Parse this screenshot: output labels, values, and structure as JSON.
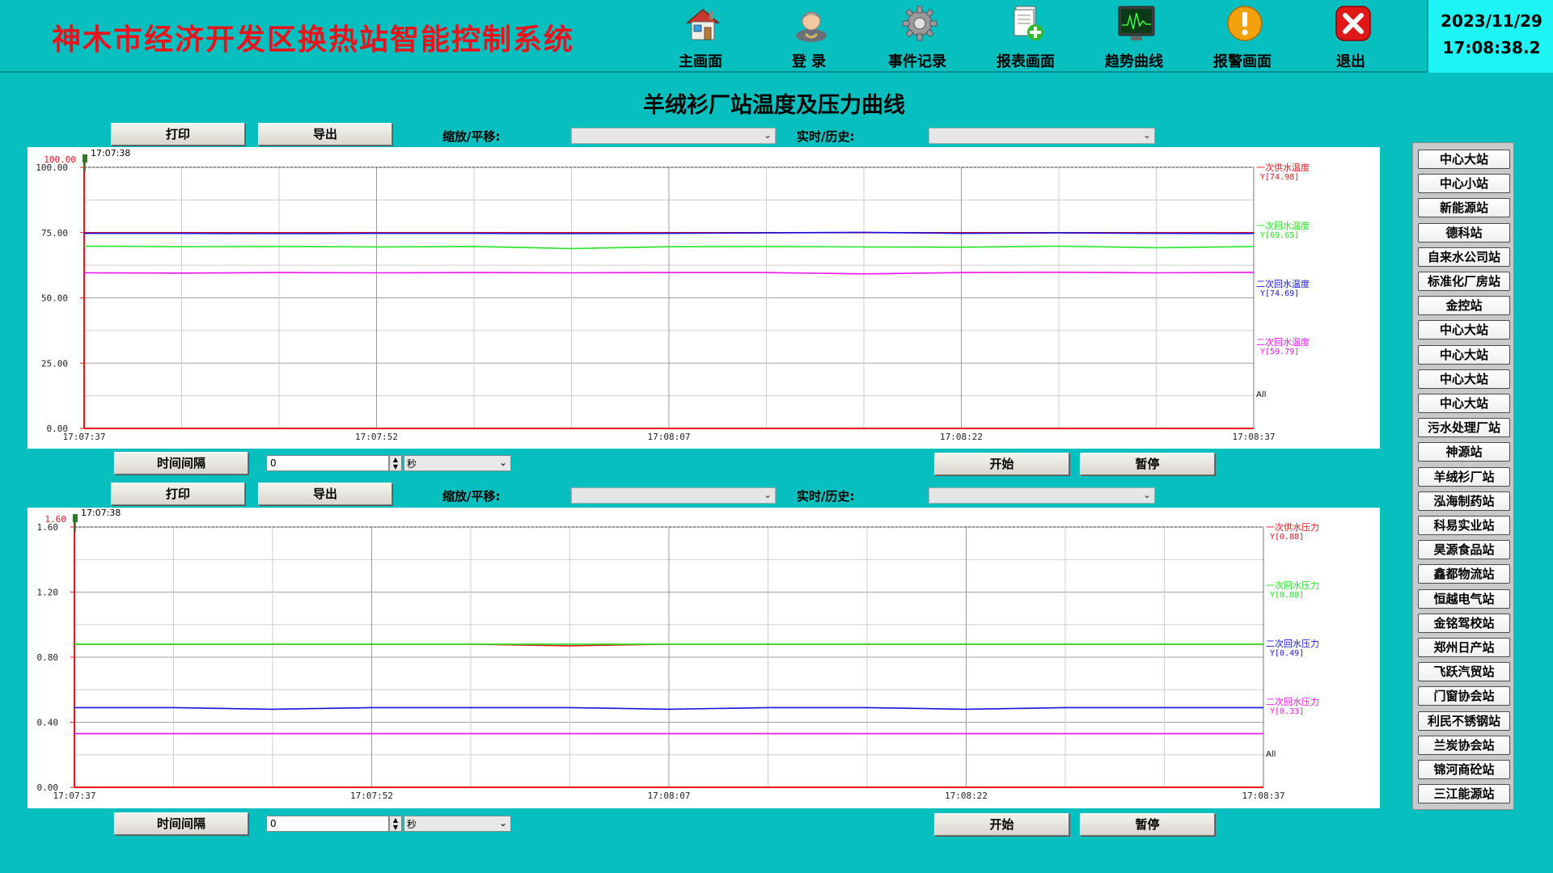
{
  "header": {
    "app_title": "神木市经济开发区换热站智能控制系统",
    "nav": [
      {
        "label": "主画面",
        "icon": "home-icon"
      },
      {
        "label": "登  录",
        "icon": "user-icon"
      },
      {
        "label": "事件记录",
        "icon": "gear-icon"
      },
      {
        "label": "报表画面",
        "icon": "report-add-icon"
      },
      {
        "label": "趋势曲线",
        "icon": "trend-monitor-icon"
      },
      {
        "label": "报警画面",
        "icon": "warning-icon"
      },
      {
        "label": "退出",
        "icon": "exit-icon"
      }
    ],
    "date": "2023/11/29",
    "time": "17:08:38.2"
  },
  "page_title": "羊绒衫厂站温度及压力曲线",
  "toolbar": {
    "print_label": "打印",
    "export_label": "导出",
    "zoom_label": "缩放/平移:",
    "mode_label": "实时/历史:",
    "interval_label": "时间间隔",
    "interval_value": "0",
    "interval_unit": "秒",
    "start_label": "开始",
    "pause_label": "暂停"
  },
  "chart_data": [
    {
      "type": "line",
      "cursor_time": "17:07:38",
      "ylim": [
        0,
        100
      ],
      "y_ticks": [
        "0.00",
        "25.00",
        "50.00",
        "75.00",
        "100.00"
      ],
      "x_ticks": [
        "17:07:37",
        "17:07:52",
        "17:08:07",
        "17:08:22",
        "17:08:37"
      ],
      "all_label": "All",
      "series": [
        {
          "name": "一次供水温度",
          "value_label": "Y[74.98]",
          "color": "#e8141c",
          "values": [
            74.98,
            74.98,
            74.98,
            74.98,
            74.98,
            74.98,
            74.98,
            74.98,
            74.98,
            74.98,
            74.98,
            74.98,
            74.98
          ]
        },
        {
          "name": "一次回水温度",
          "value_label": "Y[69.65]",
          "color": "#1ee61e",
          "values": [
            69.8,
            69.6,
            69.7,
            69.5,
            69.7,
            68.9,
            69.6,
            69.7,
            69.5,
            69.4,
            69.8,
            69.2,
            69.65
          ]
        },
        {
          "name": "二次回水温度",
          "value_label": "Y[74.69]",
          "color": "#1414e0",
          "values": [
            74.7,
            74.7,
            74.6,
            74.7,
            74.7,
            74.6,
            74.7,
            74.9,
            75.1,
            74.7,
            74.9,
            74.7,
            74.69
          ]
        },
        {
          "name": "二次回水温度",
          "value_label": "Y[59.79]",
          "color": "#ee14ee",
          "values": [
            59.6,
            59.5,
            59.7,
            59.6,
            59.7,
            59.6,
            59.7,
            59.7,
            59.2,
            59.7,
            59.8,
            59.6,
            59.79
          ]
        }
      ]
    },
    {
      "type": "line",
      "cursor_time": "17:07:38",
      "ylim": [
        0,
        1.6
      ],
      "y_ticks": [
        "0.00",
        "0.40",
        "0.80",
        "1.20",
        "1.60"
      ],
      "x_ticks": [
        "17:07:37",
        "17:07:52",
        "17:08:07",
        "17:08:22",
        "17:08:37"
      ],
      "all_label": "All",
      "series": [
        {
          "name": "一次供水压力",
          "value_label": "Y[0.88]",
          "color": "#e8141c",
          "values": [
            0.88,
            0.88,
            0.88,
            0.88,
            0.88,
            0.87,
            0.88,
            0.88,
            0.88,
            0.88,
            0.88,
            0.88,
            0.88
          ]
        },
        {
          "name": "一次回水压力",
          "value_label": "Y[0.88]",
          "color": "#1ee61e",
          "values": [
            0.88,
            0.88,
            0.88,
            0.88,
            0.88,
            0.88,
            0.88,
            0.88,
            0.88,
            0.88,
            0.88,
            0.88,
            0.88
          ]
        },
        {
          "name": "二次回水压力",
          "value_label": "Y[0.49]",
          "color": "#1414e0",
          "values": [
            0.49,
            0.49,
            0.48,
            0.49,
            0.49,
            0.49,
            0.48,
            0.49,
            0.49,
            0.48,
            0.49,
            0.49,
            0.49
          ]
        },
        {
          "name": "二次回水压力",
          "value_label": "Y[0.33]",
          "color": "#ee14ee",
          "values": [
            0.33,
            0.33,
            0.33,
            0.33,
            0.33,
            0.33,
            0.33,
            0.33,
            0.33,
            0.33,
            0.33,
            0.33,
            0.33
          ]
        }
      ]
    }
  ],
  "stations": [
    "中心大站",
    "中心小站",
    "新能源站",
    "德科站",
    "自来水公司站",
    "标准化厂房站",
    "金控站",
    "中心大站",
    "中心大站",
    "中心大站",
    "中心大站",
    "污水处理厂站",
    "神源站",
    "羊绒衫厂站",
    "泓海制药站",
    "科易实业站",
    "昊源食品站",
    "鑫都物流站",
    "恒越电气站",
    "金铭驾校站",
    "郑州日产站",
    "飞跃汽贸站",
    "门窗协会站",
    "利民不锈钢站",
    "兰炭协会站",
    "锦河商砼站",
    "三江能源站"
  ]
}
